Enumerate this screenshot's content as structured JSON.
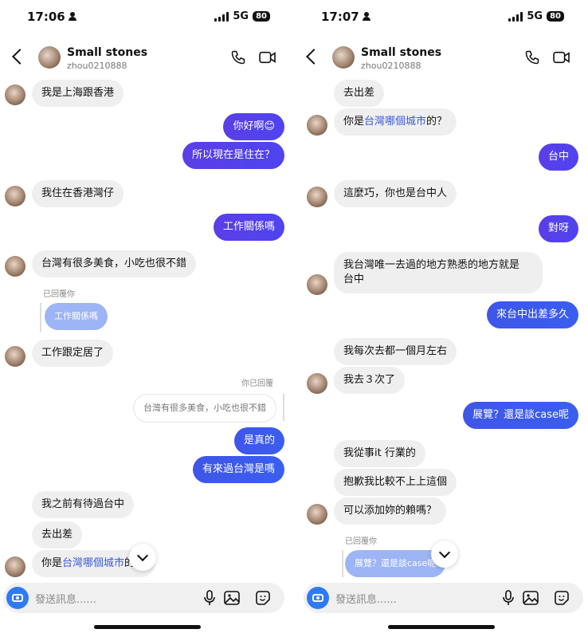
{
  "panels": [
    {
      "status": {
        "time": "17:06",
        "network": "5G",
        "battery": "80"
      },
      "header": {
        "name": "Small stones",
        "username": "zhou0210888"
      },
      "composer": {
        "placeholder": "發送訊息......"
      },
      "messages": [
        {
          "kind": "in",
          "text": "我是上海跟香港"
        },
        {
          "kind": "out",
          "text": "你好啊😊"
        },
        {
          "kind": "out",
          "text": "所以現在是住在？"
        },
        {
          "kind": "in",
          "text": "我住在香港灣仔"
        },
        {
          "kind": "out",
          "text": "工作關係嗎"
        },
        {
          "kind": "in",
          "text": "台灣有很多美食，小吃也很不錯"
        },
        {
          "kind": "reply_label",
          "text": "已回覆你"
        },
        {
          "kind": "quote_out",
          "text": "工作關係嗎"
        },
        {
          "kind": "in",
          "text": "工作跟定居了"
        },
        {
          "kind": "reply_label",
          "text": "你已回覆"
        },
        {
          "kind": "quote_in",
          "text": "台灣有很多美食，小吃也很不錯"
        },
        {
          "kind": "out",
          "text": "是真的"
        },
        {
          "kind": "out",
          "text": "有來過台灣是嗎"
        },
        {
          "kind": "in",
          "text": "我之前有待過台中"
        },
        {
          "kind": "in",
          "text": "去出差"
        },
        {
          "kind": "in",
          "prefix": "你是",
          "link": "台灣哪個城市",
          "suffix": "的？"
        }
      ]
    },
    {
      "status": {
        "time": "17:07",
        "network": "5G",
        "battery": "80"
      },
      "header": {
        "name": "Small stones",
        "username": "zhou0210888"
      },
      "composer": {
        "placeholder": "發送訊息......"
      },
      "messages": [
        {
          "kind": "in",
          "text": "去出差"
        },
        {
          "kind": "in",
          "prefix": "你是",
          "link": "台灣哪個城市",
          "suffix": "的？"
        },
        {
          "kind": "out",
          "text": "台中"
        },
        {
          "kind": "in",
          "text": "這麼巧，你也是台中人"
        },
        {
          "kind": "out",
          "text": "對呀"
        },
        {
          "kind": "in",
          "text": "我台灣唯一去過的地方熟悉的地方就是",
          "text2": "台中"
        },
        {
          "kind": "out",
          "text": "來台中出差多久"
        },
        {
          "kind": "in",
          "text": " 我每次去都一個月左右"
        },
        {
          "kind": "in",
          "text": "我去３次了"
        },
        {
          "kind": "out",
          "text": "展覽？還是談case呢"
        },
        {
          "kind": "in",
          "text": "我從事it 行業的"
        },
        {
          "kind": "in",
          "text": "抱歉我比較不上上這個"
        },
        {
          "kind": "in",
          "text": "可以添加妳的賴嗎？"
        },
        {
          "kind": "reply_label",
          "text": "已回覆你"
        },
        {
          "kind": "quote_out",
          "text": "展覽？還是談case呢"
        }
      ]
    }
  ]
}
